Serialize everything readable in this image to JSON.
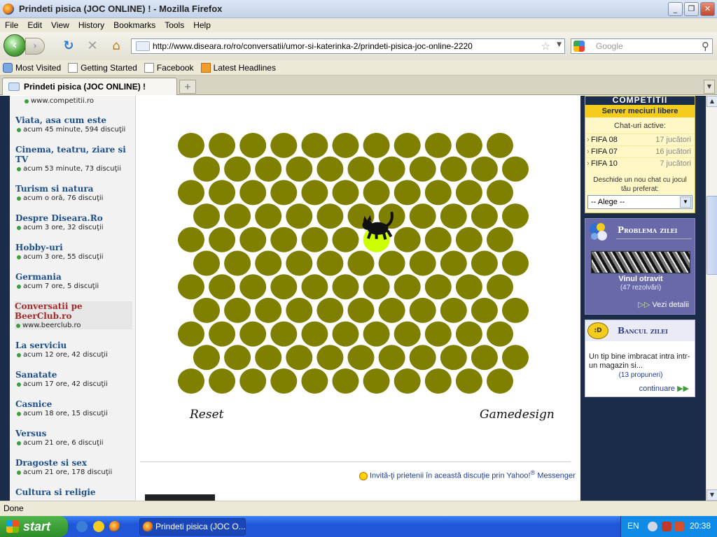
{
  "window": {
    "title": "Prindeti pisica (JOC ONLINE) ! - Mozilla Firefox",
    "minimize": "_",
    "maximize": "❐",
    "close": "✕"
  },
  "menu": [
    "File",
    "Edit",
    "View",
    "History",
    "Bookmarks",
    "Tools",
    "Help"
  ],
  "nav": {
    "url": "http://www.diseara.ro/ro/conversatii/umor-si-katerinka-2/prindeti-pisica-joc-online-2220",
    "search_placeholder": "Google"
  },
  "bookmarks": [
    "Most Visited",
    "Getting Started",
    "Facebook",
    "Latest Headlines"
  ],
  "tab": {
    "label": "Prindeti pisica (JOC ONLINE) !"
  },
  "sidebar": {
    "top_meta": "www.competitii.ro",
    "items": [
      {
        "title": "Viata, asa cum este",
        "meta": "acum 45 minute, 594 discuţii"
      },
      {
        "title": "Cinema, teatru, ziare si TV",
        "meta": "acum 53 minute, 73 discuţii"
      },
      {
        "title": "Turism si natura",
        "meta": "acum o oră, 76 discuţii"
      },
      {
        "title": "Despre Diseara.Ro",
        "meta": "acum 3 ore, 32 discuţii"
      },
      {
        "title": "Hobby-uri",
        "meta": "acum 3 ore, 55 discuţii"
      },
      {
        "title": "Germania",
        "meta": "acum 7 ore, 5 discuţii"
      },
      {
        "title": "Conversatii pe BeerClub.ro",
        "meta": "www.beerclub.ro"
      },
      {
        "title": "La serviciu",
        "meta": "acum 12 ore, 42 discuţii"
      },
      {
        "title": "Sanatate",
        "meta": "acum 17 ore, 42 discuţii"
      },
      {
        "title": "Casnice",
        "meta": "acum 18 ore, 15 discuţii"
      },
      {
        "title": "Versus",
        "meta": "acum 21 ore, 6 discuţii"
      },
      {
        "title": "Dragoste si sex",
        "meta": "acum 21 ore, 178 discuţii"
      },
      {
        "title": "Cultura si religie",
        "meta": ""
      }
    ]
  },
  "game": {
    "rows": 11,
    "cols": 11,
    "cat_row": 4,
    "cat_col": 6,
    "dot_color": "#7f7f00",
    "active_color": "#ccff00",
    "reset_label": "Reset",
    "credit_label": "Gamedesign"
  },
  "invite": {
    "text": "Invită-ţi prietenii în această discuţie prin Yahoo!",
    "registered": "®",
    "messenger": "Messenger"
  },
  "competitii": {
    "logo": "COMPETITII",
    "header": "Server meciuri libere",
    "chats_label": "Chat-uri active:",
    "chats": [
      {
        "name": "FIFA 08",
        "count": "17 jucători"
      },
      {
        "name": "FIFA 07",
        "count": "16 jucători"
      },
      {
        "name": "FIFA 10",
        "count": "7 jucători"
      }
    ],
    "new_chat": "Deschide un nou chat cu jocul tău preferat:",
    "select_value": "-- Alege --"
  },
  "problema": {
    "title": "Problema zilei",
    "name": "Vinul otravit",
    "count": "(47 rezolvări)",
    "link": "Vezi detalii"
  },
  "banc": {
    "title": "Bancul zilei",
    "text": "Un tip bine imbracat intra intr-un magazin si...",
    "count": "(13 propuneri)",
    "link": "continuare"
  },
  "status": "Done",
  "taskbar": {
    "start": "start",
    "task": "Prindeti pisica (JOC O...",
    "lang": "EN",
    "clock": "20:38"
  },
  "colors": {
    "frame_navy": "#1b2c4b",
    "link_blue": "#1d4e8c",
    "active_red": "#a12a2a"
  }
}
